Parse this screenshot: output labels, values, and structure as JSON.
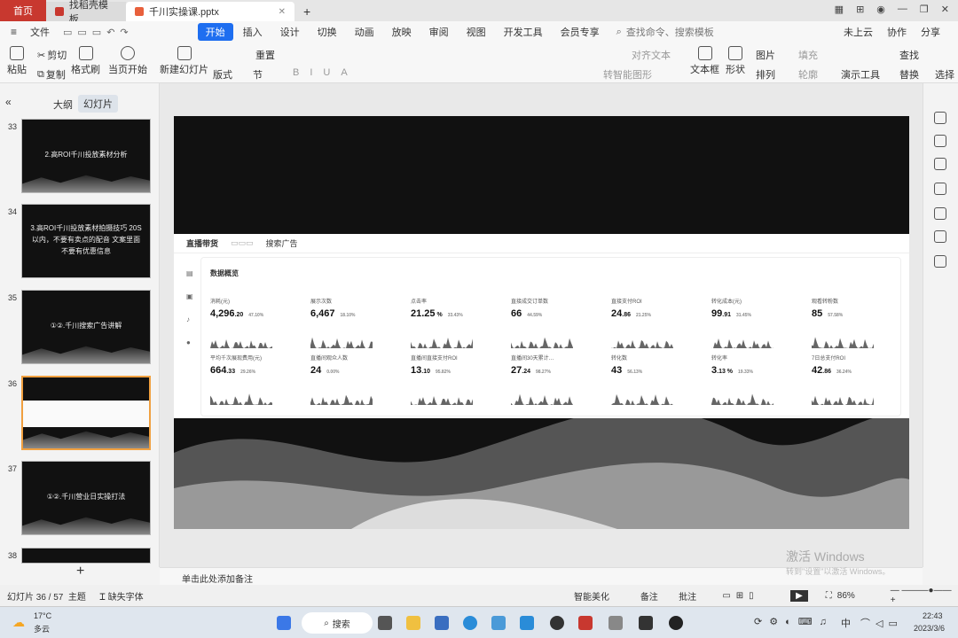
{
  "tabs": {
    "home": "首页",
    "template": "找稻壳模板",
    "doc": "千川实操课.pptx"
  },
  "menus": [
    "文件",
    "开始",
    "插入",
    "设计",
    "切换",
    "动画",
    "放映",
    "审阅",
    "视图",
    "开发工具",
    "会员专享"
  ],
  "search_placeholder": "查找命令、搜索模板",
  "cloud": "未上云",
  "collab": "协作",
  "share": "分享",
  "ribbon": {
    "paste": "粘贴",
    "cut": "剪切",
    "copy": "复制",
    "format_painter": "格式刷",
    "from_current": "当页开始",
    "new_slide": "新建幻灯片",
    "layout": "版式",
    "section": "节",
    "reset": "重置",
    "textbox": "文本框",
    "shape": "形状",
    "arrange": "排列",
    "picture": "图片",
    "fill": "填充",
    "outline": "轮廓",
    "tools": "演示工具",
    "find": "查找",
    "replace": "替换",
    "select": "选择",
    "align_text": "对齐文本",
    "convert": "转智能图形"
  },
  "panel_tabs": {
    "outline": "大纲",
    "slides": "幻灯片"
  },
  "thumbs": [
    {
      "num": "33",
      "text": "2.高ROI千川投放素材分析"
    },
    {
      "num": "34",
      "text": "3.高ROI千川投放素材拍摄技巧 20S以内，不要有卖点的配音 文案里面不要有优惠信息"
    },
    {
      "num": "35",
      "text": "①②.千川搜索广告讲解"
    },
    {
      "num": "36",
      "text": ""
    },
    {
      "num": "37",
      "text": "①②.千川营业日实操打法"
    },
    {
      "num": "38",
      "text": ""
    }
  ],
  "dash": {
    "title": "直播带货",
    "tab2": "搜索广告",
    "section": "数据概览"
  },
  "metrics": [
    {
      "label": "消耗(元)",
      "int": "4,296",
      "dec": ".20",
      "chg": "47.10%"
    },
    {
      "label": "展示次数",
      "int": "6,467",
      "dec": "",
      "chg": "18.10%"
    },
    {
      "label": "点击率",
      "int": "21.25",
      "dec": " %",
      "chg": "33.43%"
    },
    {
      "label": "直接成交订单数",
      "int": "66",
      "dec": "",
      "chg": "44.59%"
    },
    {
      "label": "直接支付ROI",
      "int": "24",
      "dec": ".86",
      "chg": "21.25%"
    },
    {
      "label": "转化成本(元)",
      "int": "99",
      "dec": ".91",
      "chg": "31.45%"
    },
    {
      "label": "观看转粉数",
      "int": "85",
      "dec": "",
      "chg": "57.58%"
    },
    {
      "label": "平均千次展现费用(元)",
      "int": "664",
      "dec": ".33",
      "chg": "29.26%"
    },
    {
      "label": "直播间观众人数",
      "int": "24",
      "dec": "",
      "chg": "0.00%"
    },
    {
      "label": "直播间直接支付ROI",
      "int": "13",
      "dec": ".10",
      "chg": "95.82%"
    },
    {
      "label": "直播间30天累计…",
      "int": "27",
      "dec": ".24",
      "chg": "98.27%"
    },
    {
      "label": "转化数",
      "int": "43",
      "dec": "",
      "chg": "56.13%"
    },
    {
      "label": "转化率",
      "int": "3",
      "dec": ".13 %",
      "chg": "19.33%"
    },
    {
      "label": "7日总支付ROI",
      "int": "42",
      "dec": ".86",
      "chg": "36.24%"
    }
  ],
  "notes": "单击此处添加备注",
  "status": {
    "slide": "幻灯片 36 / 57",
    "theme": "主题",
    "font": "缺失字体",
    "beautify": "智能美化",
    "remark": "备注",
    "comment": "批注",
    "zoom": "86%"
  },
  "watermark": {
    "line1": "激活 Windows",
    "line2": "转到\"设置\"以激活 Windows。"
  },
  "taskbar": {
    "search": "搜索",
    "weather_temp": "17°C",
    "weather": "多云",
    "time": "22:43",
    "date": "2023/3/6",
    "ime": "中"
  }
}
